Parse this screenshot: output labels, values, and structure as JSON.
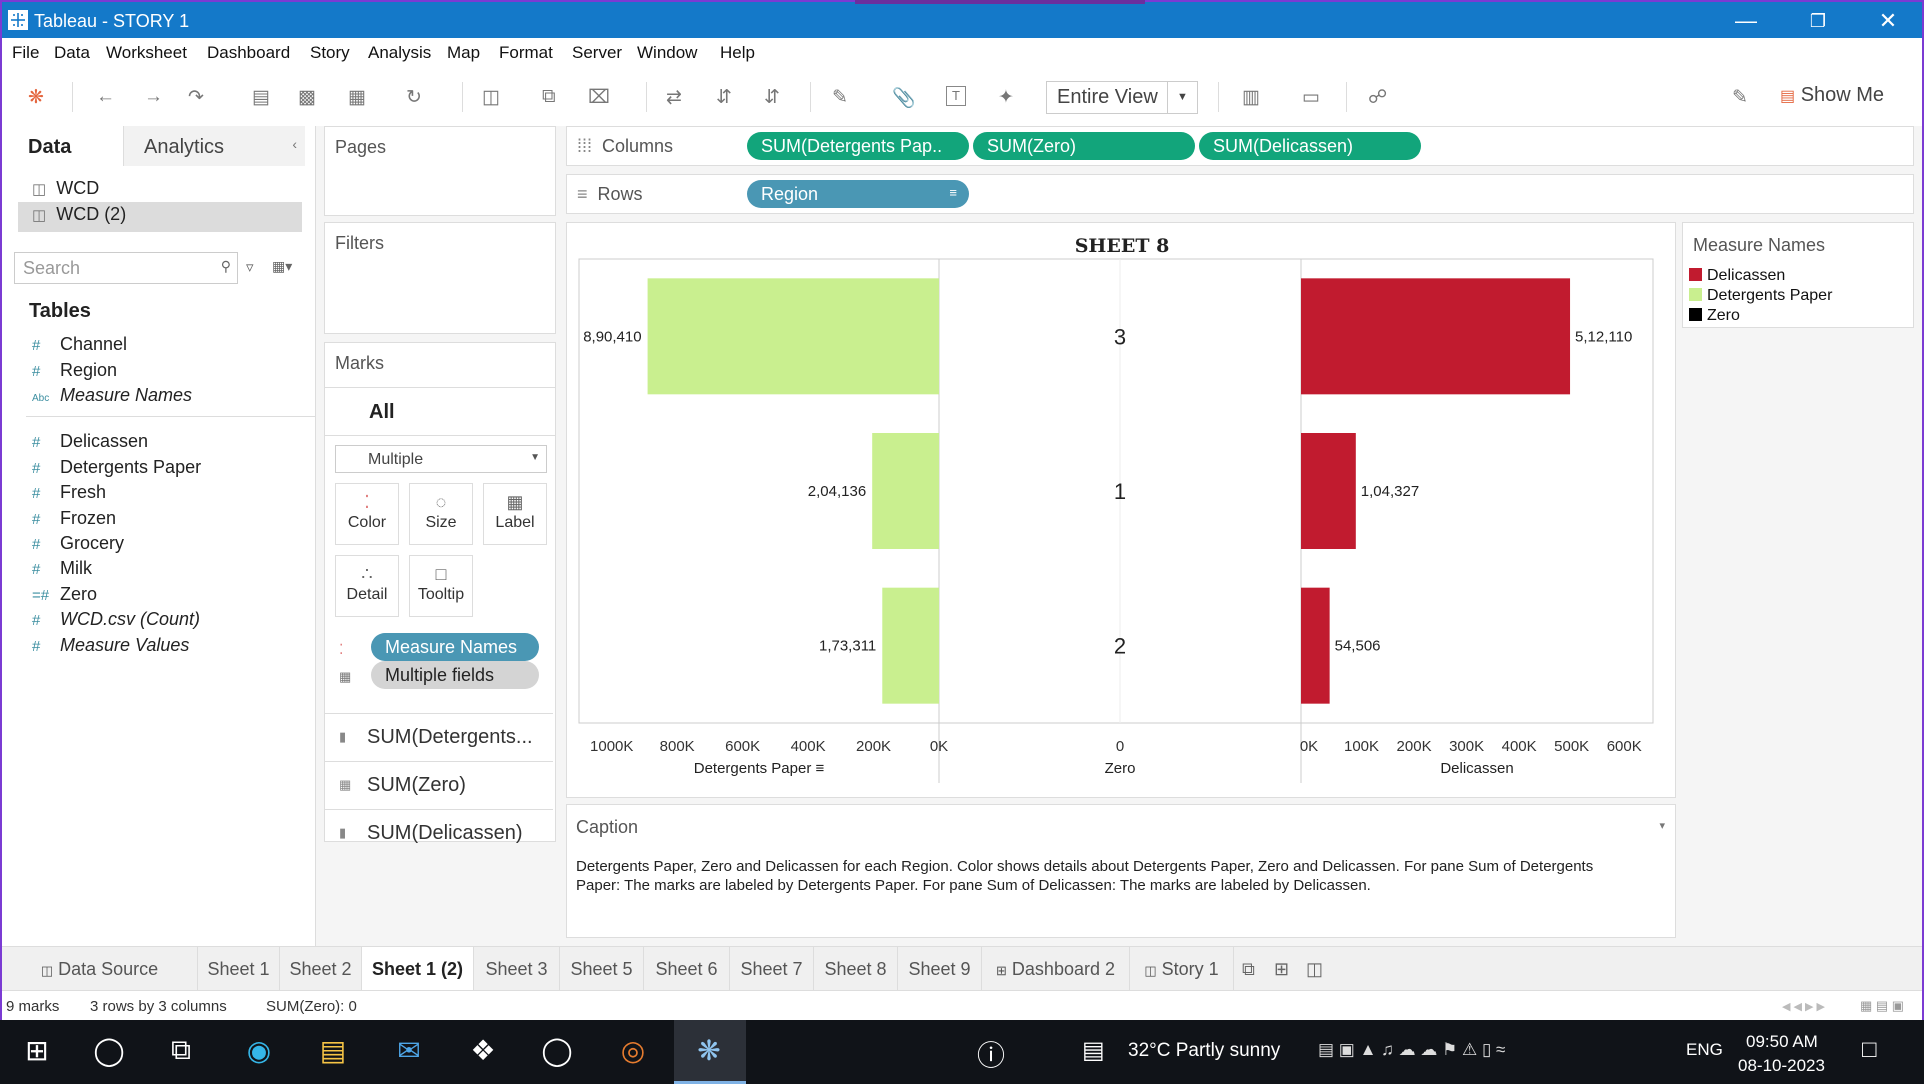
{
  "window": {
    "title": "Tableau - STORY 1"
  },
  "menu": [
    "File",
    "Data",
    "Worksheet",
    "Dashboard",
    "Story",
    "Analysis",
    "Map",
    "Format",
    "Server",
    "Window",
    "Help"
  ],
  "toolbar": {
    "fit_label": "Entire View",
    "show_me_label": "Show Me"
  },
  "data_pane": {
    "tab_data": "Data",
    "tab_analytics": "Analytics",
    "sources": [
      "WCD",
      "WCD (2)"
    ],
    "search_placeholder": "Search",
    "tables_heading": "Tables",
    "dimensions": [
      "Channel",
      "Region",
      "Measure Names"
    ],
    "measures": [
      "Delicassen",
      "Detergents Paper",
      "Fresh",
      "Frozen",
      "Grocery",
      "Milk",
      "Zero",
      "WCD.csv (Count)",
      "Measure Values"
    ]
  },
  "pages": {
    "label": "Pages"
  },
  "filters": {
    "label": "Filters"
  },
  "marks": {
    "label": "Marks",
    "all_label": "All",
    "mark_type": "Multiple",
    "cards": [
      "Color",
      "Size",
      "Label",
      "Detail",
      "Tooltip"
    ],
    "pills": [
      "Measure Names",
      "Multiple fields"
    ],
    "sections": [
      "SUM(Detergents...",
      "SUM(Zero)",
      "SUM(Delicassen)"
    ]
  },
  "shelves": {
    "columns_label": "Columns",
    "columns": [
      "SUM(Detergents Pap..",
      "SUM(Zero)",
      "SUM(Delicassen)"
    ],
    "rows_label": "Rows",
    "rows": [
      "Region"
    ]
  },
  "chart_data": {
    "type": "bar",
    "title": "SHEET 8",
    "categories": [
      "3",
      "1",
      "2"
    ],
    "series": [
      {
        "name": "Detergents Paper",
        "values": [
          890410,
          204136,
          173311
        ],
        "labels": [
          "8,90,410",
          "2,04,136",
          "1,73,311"
        ],
        "color": "#c9ef8f",
        "axis_title": "Detergents Paper",
        "reversed": true,
        "xlim": [
          0,
          1100000
        ],
        "ticks": [
          "1000K",
          "800K",
          "600K",
          "400K",
          "200K",
          "0K"
        ]
      },
      {
        "name": "Zero",
        "values": [
          0,
          0,
          0
        ],
        "color": "#000000",
        "axis_title": "Zero",
        "ticks": [
          "0"
        ]
      },
      {
        "name": "Delicassen",
        "values": [
          512110,
          104327,
          54506
        ],
        "labels": [
          "5,12,110",
          "1,04,327",
          "54,506"
        ],
        "color": "#c11b2f",
        "axis_title": "Delicassen",
        "xlim": [
          0,
          670000
        ],
        "ticks": [
          "0K",
          "100K",
          "200K",
          "300K",
          "400K",
          "500K",
          "600K"
        ]
      }
    ]
  },
  "legend": {
    "title": "Measure Names",
    "items": [
      {
        "label": "Delicassen",
        "color": "#c11b2f"
      },
      {
        "label": "Detergents Paper",
        "color": "#c9ef8f"
      },
      {
        "label": "Zero",
        "color": "#000000"
      }
    ]
  },
  "caption": {
    "title": "Caption",
    "text": "Detergents Paper, Zero and Delicassen for each Region.  Color shows details about Detergents Paper, Zero and Delicassen.  For pane Sum of Detergents Paper:  The marks are labeled by Detergents Paper.  For pane Sum of Delicassen:  The marks are labeled by Delicassen."
  },
  "sheet_tabs": [
    "Data Source",
    "Sheet 1",
    "Sheet 2",
    "Sheet 1 (2)",
    "Sheet 3",
    "Sheet 5",
    "Sheet 6",
    "Sheet 7",
    "Sheet 8",
    "Sheet 9",
    "Dashboard 2",
    "Story 1"
  ],
  "active_tab": "Sheet 1 (2)",
  "status": {
    "marks": "9 marks",
    "dims": "3 rows by 3 columns",
    "sum": "SUM(Zero): 0"
  },
  "taskbar": {
    "weather": "32°C  Partly sunny",
    "lang": "ENG",
    "time": "09:50 AM",
    "date": "08-10-2023"
  }
}
